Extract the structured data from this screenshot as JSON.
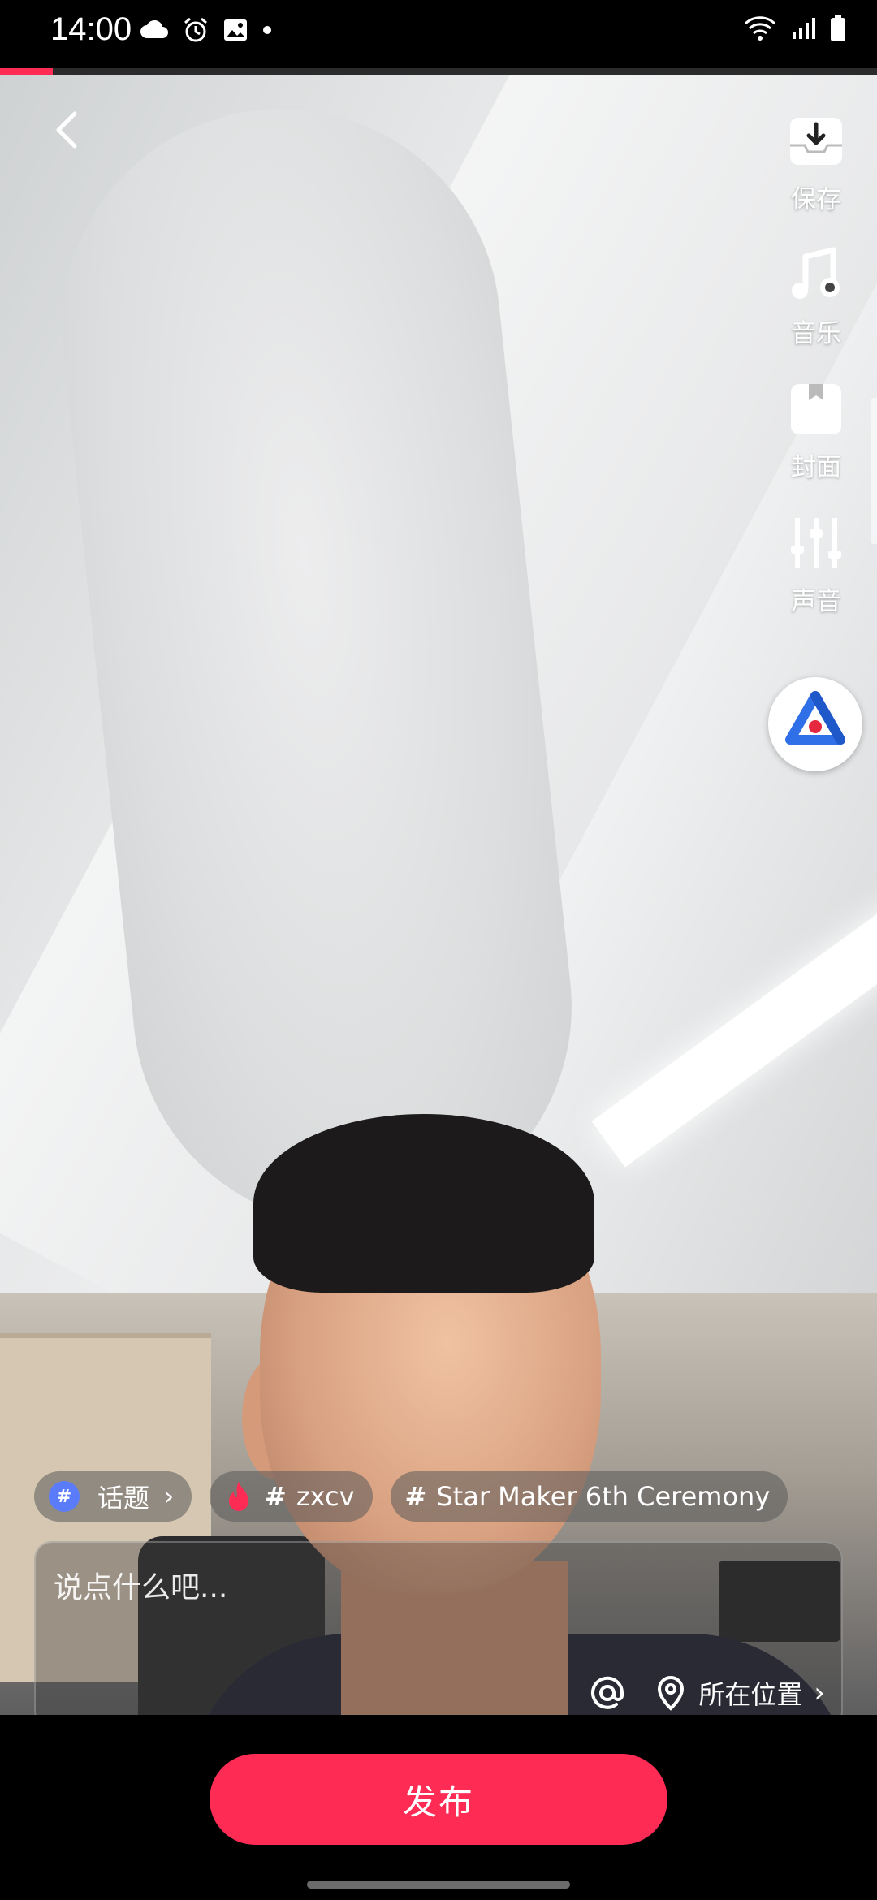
{
  "status_bar": {
    "time": "14:00",
    "left_icons": [
      "cloud-icon",
      "alarm-icon",
      "gallery-icon",
      "dot-icon"
    ],
    "right_icons": [
      "wifi-icon",
      "signal-icon",
      "battery-icon"
    ]
  },
  "upload_progress": 0.06,
  "accent_color": "#fe2c55",
  "tools": [
    {
      "icon": "save-icon",
      "label": "保存"
    },
    {
      "icon": "music-icon",
      "label": "音乐"
    },
    {
      "icon": "cover-icon",
      "label": "封面"
    },
    {
      "icon": "sound-mixer-icon",
      "label": "声音"
    }
  ],
  "chips": {
    "topic": {
      "label": "话题"
    },
    "tag1": {
      "label": "zxcv"
    },
    "tag2": {
      "label": "Star Maker 6th Ceremony"
    }
  },
  "caption": {
    "placeholder": "说点什么吧..."
  },
  "location": {
    "label": "所在位置"
  },
  "publish": {
    "label": "发布"
  }
}
